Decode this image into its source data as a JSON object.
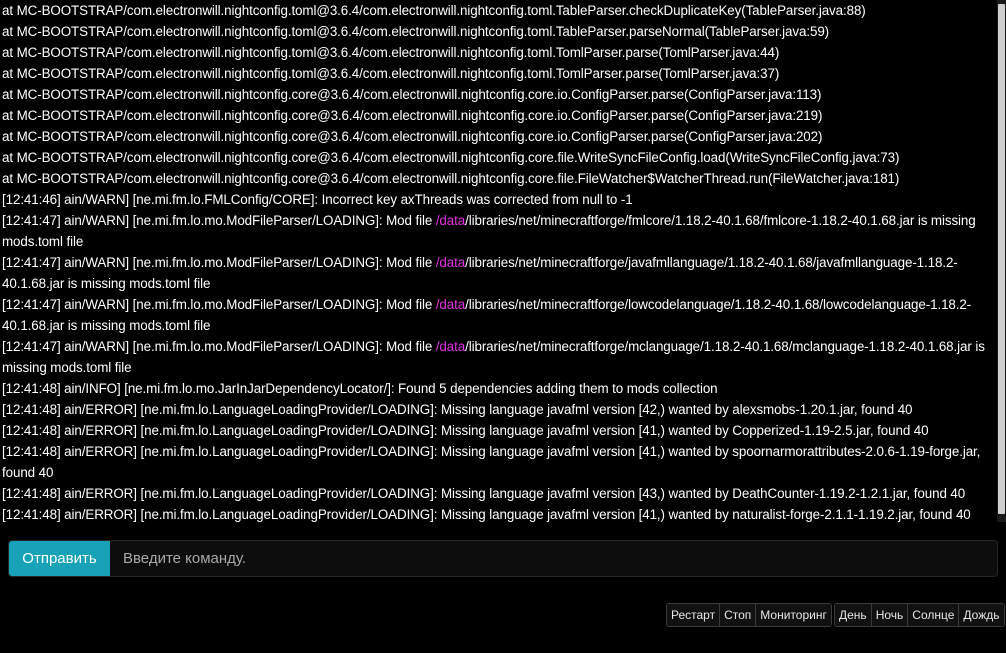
{
  "console": {
    "lines": [
      [
        {
          "t": "at MC-BOOTSTRAP/com.electronwill.nightconfig.toml@3.6.4/com.electronwill.nightconfig.toml.TableParser.checkDuplicateKey(TableParser.java:88)"
        }
      ],
      [
        {
          "t": "at MC-BOOTSTRAP/com.electronwill.nightconfig.toml@3.6.4/com.electronwill.nightconfig.toml.TableParser.parseNormal(TableParser.java:59)"
        }
      ],
      [
        {
          "t": "at MC-BOOTSTRAP/com.electronwill.nightconfig.toml@3.6.4/com.electronwill.nightconfig.toml.TomlParser.parse(TomlParser.java:44)"
        }
      ],
      [
        {
          "t": "at MC-BOOTSTRAP/com.electronwill.nightconfig.toml@3.6.4/com.electronwill.nightconfig.toml.TomlParser.parse(TomlParser.java:37)"
        }
      ],
      [
        {
          "t": "at MC-BOOTSTRAP/com.electronwill.nightconfig.core@3.6.4/com.electronwill.nightconfig.core.io.ConfigParser.parse(ConfigParser.java:113)"
        }
      ],
      [
        {
          "t": "at MC-BOOTSTRAP/com.electronwill.nightconfig.core@3.6.4/com.electronwill.nightconfig.core.io.ConfigParser.parse(ConfigParser.java:219)"
        }
      ],
      [
        {
          "t": "at MC-BOOTSTRAP/com.electronwill.nightconfig.core@3.6.4/com.electronwill.nightconfig.core.io.ConfigParser.parse(ConfigParser.java:202)"
        }
      ],
      [
        {
          "t": "at MC-BOOTSTRAP/com.electronwill.nightconfig.core@3.6.4/com.electronwill.nightconfig.core.file.WriteSyncFileConfig.load(WriteSyncFileConfig.java:73)"
        }
      ],
      [
        {
          "t": "at MC-BOOTSTRAP/com.electronwill.nightconfig.core@3.6.4/com.electronwill.nightconfig.core.file.FileWatcher$WatcherThread.run(FileWatcher.java:181)"
        }
      ],
      [
        {
          "t": "[12:41:46] ain/WARN] [ne.mi.fm.lo.FMLConfig/CORE]: Incorrect key axThreads was corrected from null to -1"
        }
      ],
      [
        {
          "t": "[12:41:47] ain/WARN] [ne.mi.fm.lo.mo.ModFileParser/LOADING]: Mod file "
        },
        {
          "t": "/data",
          "hl": true
        },
        {
          "t": "/libraries/net/minecraftforge/fmlcore/1.18.2-40.1.68/fmlcore-1.18.2-40.1.68.jar is missing mods.toml file"
        }
      ],
      [
        {
          "t": "[12:41:47] ain/WARN] [ne.mi.fm.lo.mo.ModFileParser/LOADING]: Mod file "
        },
        {
          "t": "/data",
          "hl": true
        },
        {
          "t": "/libraries/net/minecraftforge/javafmllanguage/1.18.2-40.1.68/javafmllanguage-1.18.2-40.1.68.jar is missing mods.toml file"
        }
      ],
      [
        {
          "t": "[12:41:47] ain/WARN] [ne.mi.fm.lo.mo.ModFileParser/LOADING]: Mod file "
        },
        {
          "t": "/data",
          "hl": true
        },
        {
          "t": "/libraries/net/minecraftforge/lowcodelanguage/1.18.2-40.1.68/lowcodelanguage-1.18.2-40.1.68.jar is missing mods.toml file"
        }
      ],
      [
        {
          "t": "[12:41:47] ain/WARN] [ne.mi.fm.lo.mo.ModFileParser/LOADING]: Mod file "
        },
        {
          "t": "/data",
          "hl": true
        },
        {
          "t": "/libraries/net/minecraftforge/mclanguage/1.18.2-40.1.68/mclanguage-1.18.2-40.1.68.jar is missing mods.toml file"
        }
      ],
      [
        {
          "t": "[12:41:48] ain/INFO] [ne.mi.fm.lo.mo.JarInJarDependencyLocator/]: Found 5 dependencies adding them to mods collection"
        }
      ],
      [
        {
          "t": "[12:41:48] ain/ERROR] [ne.mi.fm.lo.LanguageLoadingProvider/LOADING]: Missing language javafml version [42,) wanted by alexsmobs-1.20.1.jar, found 40"
        }
      ],
      [
        {
          "t": "[12:41:48] ain/ERROR] [ne.mi.fm.lo.LanguageLoadingProvider/LOADING]: Missing language javafml version [41,) wanted by Copperized-1.19-2.5.jar, found 40"
        }
      ],
      [
        {
          "t": "[12:41:48] ain/ERROR] [ne.mi.fm.lo.LanguageLoadingProvider/LOADING]: Missing language javafml version [41,) wanted by spoornarmorattributes-2.0.6-1.19-forge.jar, found 40"
        }
      ],
      [
        {
          "t": "[12:41:48] ain/ERROR] [ne.mi.fm.lo.LanguageLoadingProvider/LOADING]: Missing language javafml version [43,) wanted by DeathCounter-1.19.2-1.2.1.jar, found 40"
        }
      ],
      [
        {
          "t": "[12:41:48] ain/ERROR] [ne.mi.fm.lo.LanguageLoadingProvider/LOADING]: Missing language javafml version [41,) wanted by naturalist-forge-2.1.1-1.19.2.jar, found 40"
        }
      ]
    ],
    "highlight_color": "#e032e0"
  },
  "command": {
    "send_label": "Отправить",
    "placeholder": "Введите команду.",
    "value": ""
  },
  "server_controls": {
    "restart_label": "Рестарт",
    "stop_label": "Стоп",
    "monitoring_label": "Мониторинг"
  },
  "world_controls": {
    "day_label": "День",
    "night_label": "Ночь",
    "sun_label": "Солнце",
    "rain_label": "Дождь"
  },
  "colors": {
    "accent": "#17a2b8",
    "background": "#000000"
  }
}
